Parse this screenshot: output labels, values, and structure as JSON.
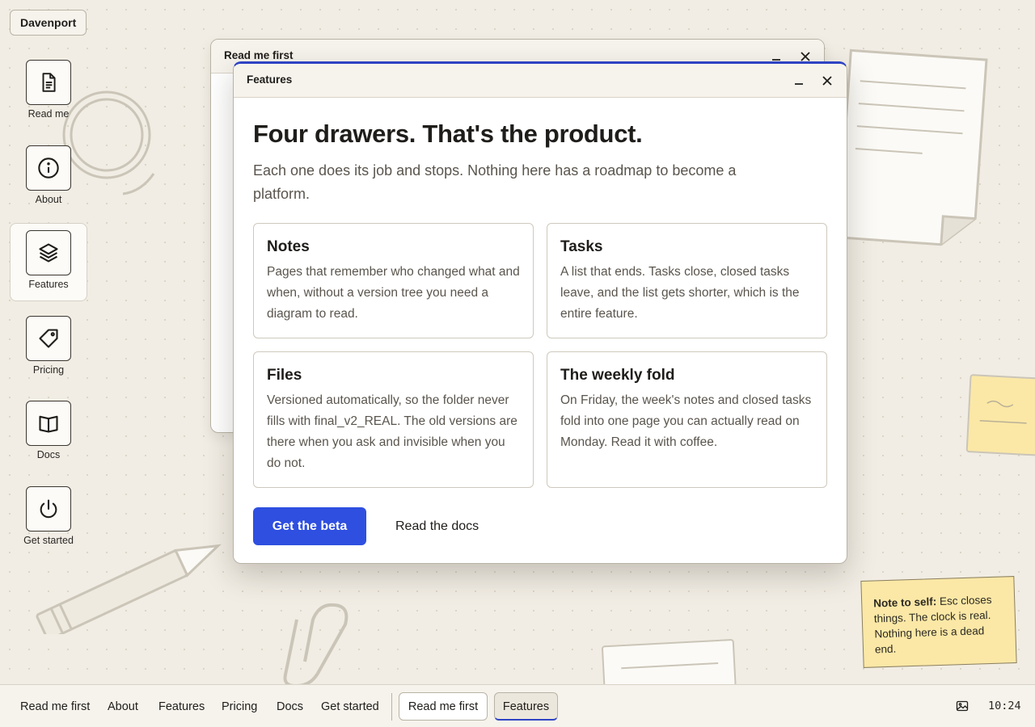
{
  "brand": "Davenport",
  "desktop_icons": [
    {
      "label": "Read me",
      "icon": "document-icon"
    },
    {
      "label": "About",
      "icon": "info-icon"
    },
    {
      "label": "Features",
      "icon": "layers-icon"
    },
    {
      "label": "Pricing",
      "icon": "tag-icon"
    },
    {
      "label": "Docs",
      "icon": "book-icon"
    },
    {
      "label": "Get started",
      "icon": "power-icon"
    }
  ],
  "back_window": {
    "title": "Read me first"
  },
  "front_window": {
    "title": "Features",
    "headline": "Four drawers. That's the product.",
    "subhead": "Each one does its job and stops. Nothing here has a roadmap to become a platform.",
    "cards": [
      {
        "title": "Notes",
        "body": "Pages that remember who changed what and when, without a version tree you need a diagram to read."
      },
      {
        "title": "Tasks",
        "body": "A list that ends. Tasks close, closed tasks leave, and the list gets shorter, which is the entire feature."
      },
      {
        "title": "Files",
        "body": "Versioned automatically, so the folder never fills with final_v2_REAL. The old versions are there when you ask and invisible when you do not."
      },
      {
        "title": "The weekly fold",
        "body": "On Friday, the week's notes and closed tasks fold into one page you can actually read on Monday. Read it with coffee."
      }
    ],
    "primary_button": "Get the beta",
    "secondary_button": "Read the docs"
  },
  "sticky_note": {
    "bold": "Note to self:",
    "text": " Esc closes things. The clock is real. Nothing here is a dead end."
  },
  "taskbar": {
    "links": [
      "Read me first",
      "About",
      "Features",
      "Pricing",
      "Docs",
      "Get started"
    ],
    "tasks": [
      "Read me first",
      "Features"
    ],
    "active_task": "Features",
    "clock": "10:24"
  },
  "colors": {
    "accent": "#2e4fe0",
    "background": "#f1ede4",
    "note": "#fbe8a6"
  }
}
